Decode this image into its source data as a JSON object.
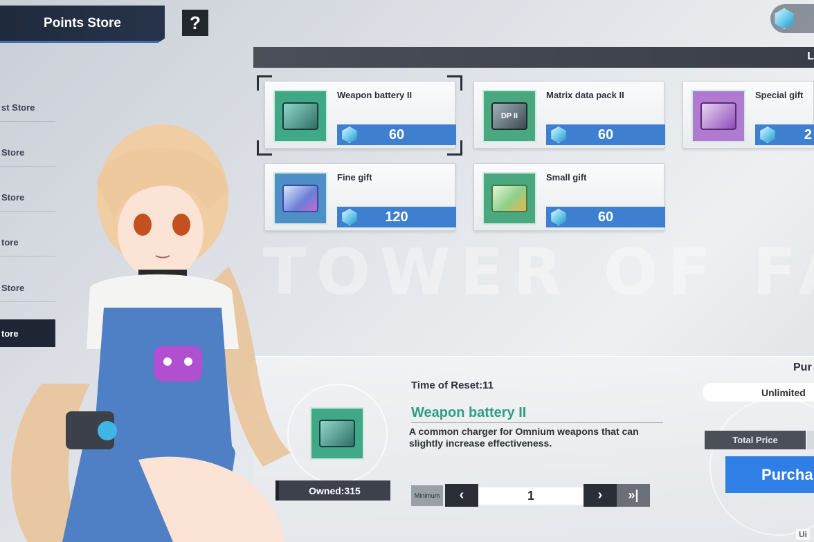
{
  "header": {
    "title": "Points Store",
    "help_label": "?",
    "strip_label": "L"
  },
  "watermark": "TOWER OF FANTASY",
  "sidebar": {
    "items": [
      {
        "label": "st Store"
      },
      {
        "label": "Store"
      },
      {
        "label": "Store"
      },
      {
        "label": "tore"
      },
      {
        "label": "Store"
      },
      {
        "label": "tore",
        "active": true
      }
    ]
  },
  "products": [
    {
      "name": "Weapon battery II",
      "price": "60",
      "icon": "weapon-battery-icon",
      "selected": true
    },
    {
      "name": "Matrix data pack II",
      "price": "60",
      "icon": "matrix-data-pack-icon"
    },
    {
      "name": "Special gift",
      "price": "2",
      "icon": "special-gift-icon"
    },
    {
      "name": "Fine gift",
      "price": "120",
      "icon": "fine-gift-icon"
    },
    {
      "name": "Small gift",
      "price": "60",
      "icon": "small-gift-icon"
    }
  ],
  "thumb_labels": {
    "matrix": "DP II"
  },
  "detail": {
    "reset": "Time of Reset:11",
    "title": "Weapon battery II",
    "description": "A common charger for Omnium weapons that can slightly increase effectiveness.",
    "owned": "Owned:315",
    "min_label": "Minimum",
    "quantity": "1",
    "prev_label": "‹",
    "next_label": "›",
    "max_label": "»|"
  },
  "purchase": {
    "section_label": "Pur",
    "limit": "Unlimited",
    "total_label": "Total Price",
    "button_label": "Purcha"
  },
  "corner_mark": "Ui",
  "colors": {
    "accent_blue": "#3f7fd0",
    "title_teal": "#2e9d82",
    "dark": "#1f2535"
  }
}
